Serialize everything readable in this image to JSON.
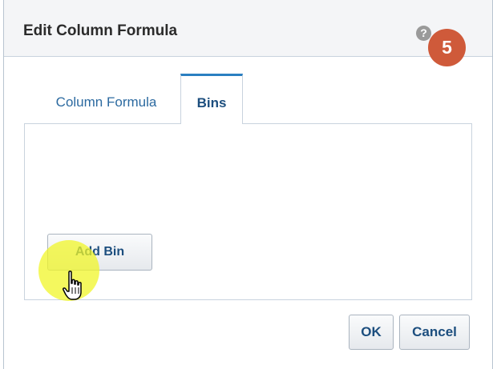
{
  "dialog": {
    "title": "Edit Column Formula",
    "help_icon": "help-icon",
    "help_glyph": "?",
    "step_badge": "5"
  },
  "tabs": [
    {
      "label": "Column Formula",
      "active": false
    },
    {
      "label": "Bins",
      "active": true
    }
  ],
  "bins_panel": {
    "add_bin_label": "Add Bin"
  },
  "footer": {
    "ok_label": "OK",
    "cancel_label": "Cancel"
  },
  "cursor": {
    "icon": "hand-pointer-icon",
    "highlight_color": "#f0f628"
  },
  "colors": {
    "accent": "#2a7fc1",
    "badge": "#cf5a3a",
    "link": "#2c6aa0"
  }
}
